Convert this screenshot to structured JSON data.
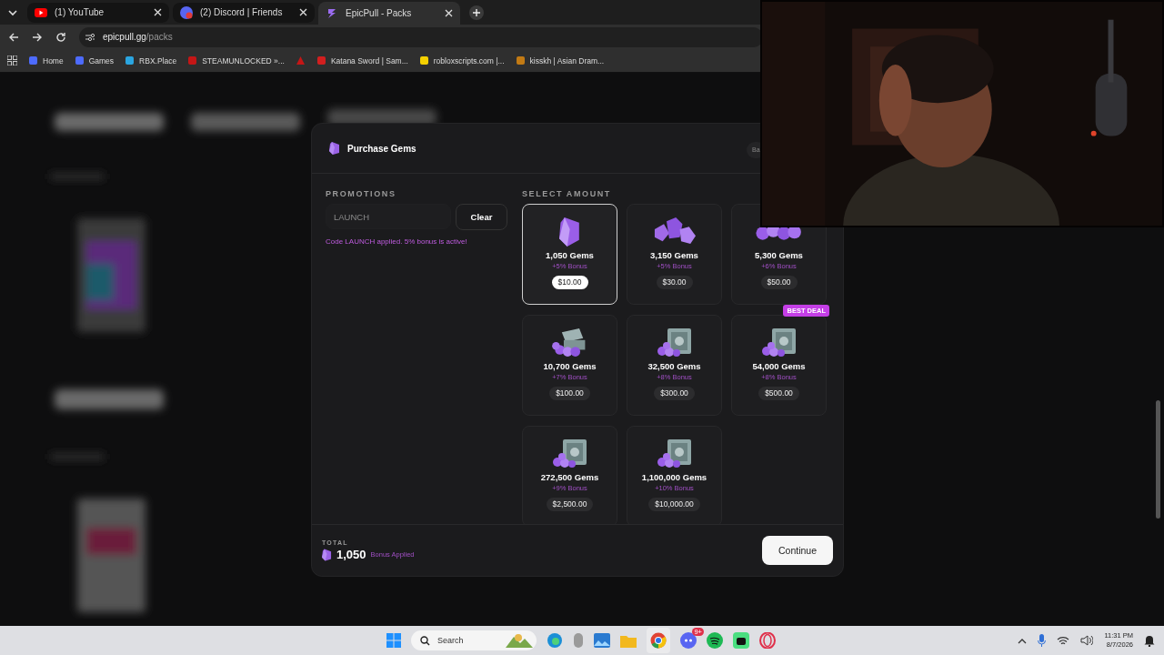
{
  "browser": {
    "tabs": [
      {
        "title": "(1) YouTube",
        "selected": false
      },
      {
        "title": "(2) Discord | Friends",
        "selected": false
      },
      {
        "title": "EpicPull - Packs",
        "selected": true
      }
    ],
    "address": {
      "host": "epicpull.gg",
      "path": "/packs"
    },
    "bookmarks": [
      {
        "kind": "link",
        "label": "Home"
      },
      {
        "kind": "link",
        "label": "Games"
      },
      {
        "kind": "link",
        "label": "RBX.Place"
      },
      {
        "kind": "link",
        "label": "STEAMUNLOCKED »..."
      },
      {
        "kind": "icon"
      },
      {
        "kind": "link",
        "label": "Katana Sword | Sam..."
      },
      {
        "kind": "link",
        "label": "robloxscripts.com |..."
      },
      {
        "kind": "link",
        "label": "kisskh | Asian Dram..."
      }
    ]
  },
  "dialog": {
    "title": "Purchase Gems",
    "balance_label": "Ba",
    "promotions": {
      "heading": "PROMOTIONS",
      "code": {
        "value": "LAUNCH"
      },
      "clear_button": "Clear",
      "message": "Code LAUNCH applied. 5% bonus is active!"
    },
    "select": {
      "heading": "SELECT AMOUNT",
      "packs": [
        {
          "gems": "1,050 Gems",
          "bonus": "+5% Bonus",
          "price": "$10.00",
          "selected": true,
          "kind": "crystal"
        },
        {
          "gems": "3,150 Gems",
          "bonus": "+5% Bonus",
          "price": "$30.00",
          "selected": false,
          "kind": "cluster"
        },
        {
          "gems": "5,300 Gems",
          "bonus": "+6% Bonus",
          "price": "$50.00",
          "selected": false,
          "kind": "row"
        },
        {
          "gems": "10,700 Gems",
          "bonus": "+7% Bonus",
          "price": "$100.00",
          "selected": false,
          "kind": "chest"
        },
        {
          "gems": "32,500 Gems",
          "bonus": "+8% Bonus",
          "price": "$300.00",
          "selected": false,
          "kind": "safe"
        },
        {
          "gems": "54,000 Gems",
          "bonus": "+8% Bonus",
          "price": "$500.00",
          "selected": false,
          "kind": "safe",
          "badge": "BEST DEAL"
        },
        {
          "gems": "272,500 Gems",
          "bonus": "+9% Bonus",
          "price": "$2,500.00",
          "selected": false,
          "kind": "safe"
        },
        {
          "gems": "1,100,000 Gems",
          "bonus": "+10% Bonus",
          "price": "$10,000.00",
          "selected": false,
          "kind": "safe"
        }
      ]
    },
    "footer": {
      "label": "TOTAL",
      "amount": "1,050",
      "note": "Bonus Applied",
      "button": "Continue"
    }
  },
  "taskbar": {
    "search_placeholder": "Search",
    "discord_badge": "9+",
    "time": "11:31 PM",
    "date": "8/7/2026"
  }
}
